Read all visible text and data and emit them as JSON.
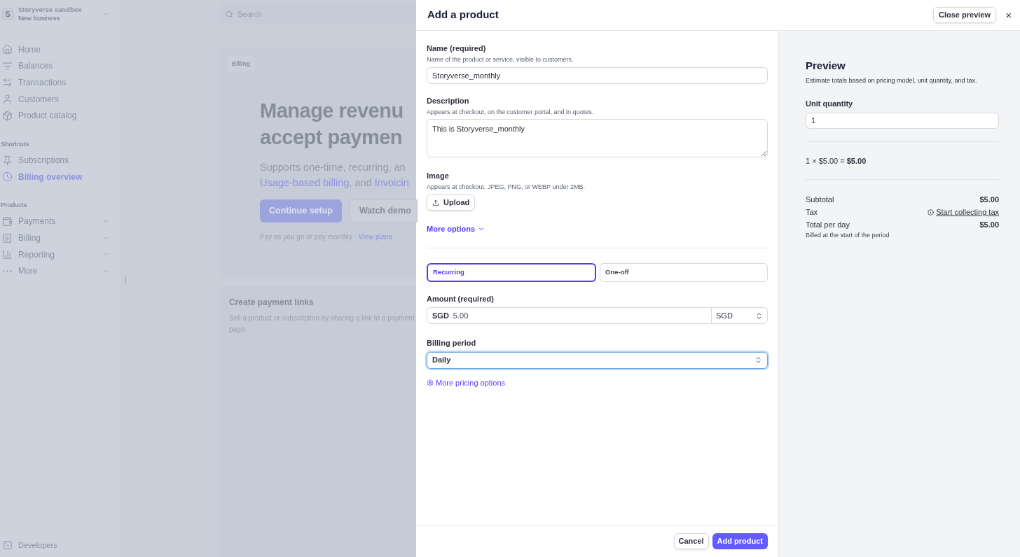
{
  "account": {
    "initial": "S",
    "name": "Storyverse sandbox",
    "subtitle": "New business"
  },
  "sidebar": {
    "main": [
      {
        "label": "Home",
        "selected": false,
        "kind": "link"
      },
      {
        "label": "Balances",
        "selected": false,
        "kind": "link"
      },
      {
        "label": "Transactions",
        "selected": false,
        "kind": "link"
      },
      {
        "label": "Customers",
        "selected": false,
        "kind": "link"
      },
      {
        "label": "Product catalog",
        "selected": false,
        "kind": "link"
      }
    ],
    "shortcuts": {
      "heading": "Shortcuts",
      "items": [
        {
          "label": "Subscriptions",
          "selected": false,
          "kind": "link"
        },
        {
          "label": "Billing overview",
          "selected": true,
          "kind": "link"
        }
      ]
    },
    "products": {
      "heading": "Products",
      "items": [
        {
          "label": "Payments",
          "selected": false,
          "kind": "menu"
        },
        {
          "label": "Billing",
          "selected": false,
          "kind": "menu"
        },
        {
          "label": "Reporting",
          "selected": false,
          "kind": "menu"
        },
        {
          "label": "More",
          "selected": false,
          "kind": "menu"
        }
      ]
    },
    "footer": {
      "label": "Developers"
    }
  },
  "search": {
    "placeholder": "Search"
  },
  "hero": {
    "badge": "Billing",
    "title_lines": [
      "Manage revenu",
      "accept paymen"
    ],
    "text": "Supports one-time, recurring, an",
    "links": [
      "Usage-based billing"
    ],
    "text_2": ", and ",
    "link_2": "Invoicin",
    "primary_button": "Continue setup",
    "secondary_button": "Watch demo",
    "note": "Pay as you go or pay monthly · ",
    "note_link": "View plans"
  },
  "card": {
    "title": "Create payment links",
    "text": "Sell a product or subscription by sharing a link to a payment page."
  },
  "drawer": {
    "title": "Add a product",
    "close_preview": "Close preview",
    "close": "×",
    "name": {
      "label": "Name (required)",
      "hint": "Name of the product or service, visible to customers.",
      "value": "Storyverse_monthly"
    },
    "description": {
      "label": "Description",
      "hint": "Appears at checkout, on the customer portal, and in quotes.",
      "value": "This is Storyverse_monthly"
    },
    "image": {
      "label": "Image",
      "hint": "Appears at checkout. JPEG, PNG, or WEBP under 2MB.",
      "button": "Upload"
    },
    "more_options": "More options",
    "pricing_types": [
      {
        "label": "Recurring",
        "selected": true
      },
      {
        "label": "One-off",
        "selected": false
      }
    ],
    "amount": {
      "label": "Amount (required)",
      "prefix": "SGD",
      "value": "5.00",
      "currency": "SGD"
    },
    "billing_period": {
      "label": "Billing period",
      "value": "Daily",
      "focused": true
    },
    "more_pricing": "More pricing options",
    "cancel": "Cancel",
    "submit": "Add product"
  },
  "preview": {
    "title": "Preview",
    "subtitle": "Estimate totals based on pricing model, unit quantity, and tax.",
    "quantity_label": "Unit quantity",
    "quantity": "1",
    "calculation": "1 × $5.00 = **$5.00**",
    "rows": [
      {
        "label": "Subtotal",
        "kind": "value",
        "value": "$5.00"
      },
      {
        "label": "Tax",
        "kind": "link",
        "value": "Start collecting tax"
      },
      {
        "label": "Total per day",
        "kind": "value",
        "value": "$5.00",
        "note": "Billed at the start of the period"
      }
    ]
  }
}
